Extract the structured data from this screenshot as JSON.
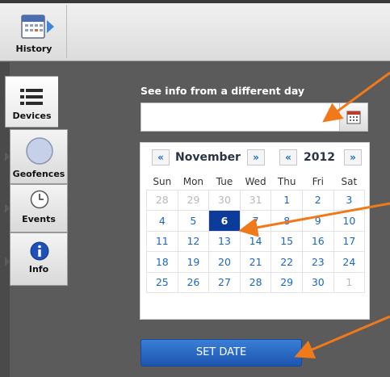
{
  "toolbar": {
    "history_label": "History"
  },
  "tabs": [
    {
      "label": "Devices",
      "icon": "list-icon"
    },
    {
      "label": "Geofences",
      "icon": "circle-icon"
    },
    {
      "label": "Events",
      "icon": "clock-icon"
    },
    {
      "label": "Info",
      "icon": "info-icon"
    }
  ],
  "panel": {
    "title": "See info from a different day",
    "date_value": "",
    "set_date_label": "SET DATE"
  },
  "calendar": {
    "prev_month": "«",
    "month": "November",
    "next_month": "»",
    "prev_year": "«",
    "year": "2012",
    "next_year": "»",
    "weekdays": [
      "Sun",
      "Mon",
      "Tue",
      "Wed",
      "Thu",
      "Fri",
      "Sat"
    ],
    "weeks": [
      [
        "28",
        "29",
        "30",
        "31",
        "1",
        "2",
        "3"
      ],
      [
        "4",
        "5",
        "6",
        "7",
        "8",
        "9",
        "10"
      ],
      [
        "11",
        "12",
        "13",
        "14",
        "15",
        "16",
        "17"
      ],
      [
        "18",
        "19",
        "20",
        "21",
        "22",
        "23",
        "24"
      ],
      [
        "25",
        "26",
        "27",
        "28",
        "29",
        "30",
        "1"
      ]
    ],
    "selected_day": "6"
  },
  "colors": {
    "accent": "#1b66c9",
    "selected": "#0c3b9c",
    "annotation_arrow": "#f07a1a"
  }
}
